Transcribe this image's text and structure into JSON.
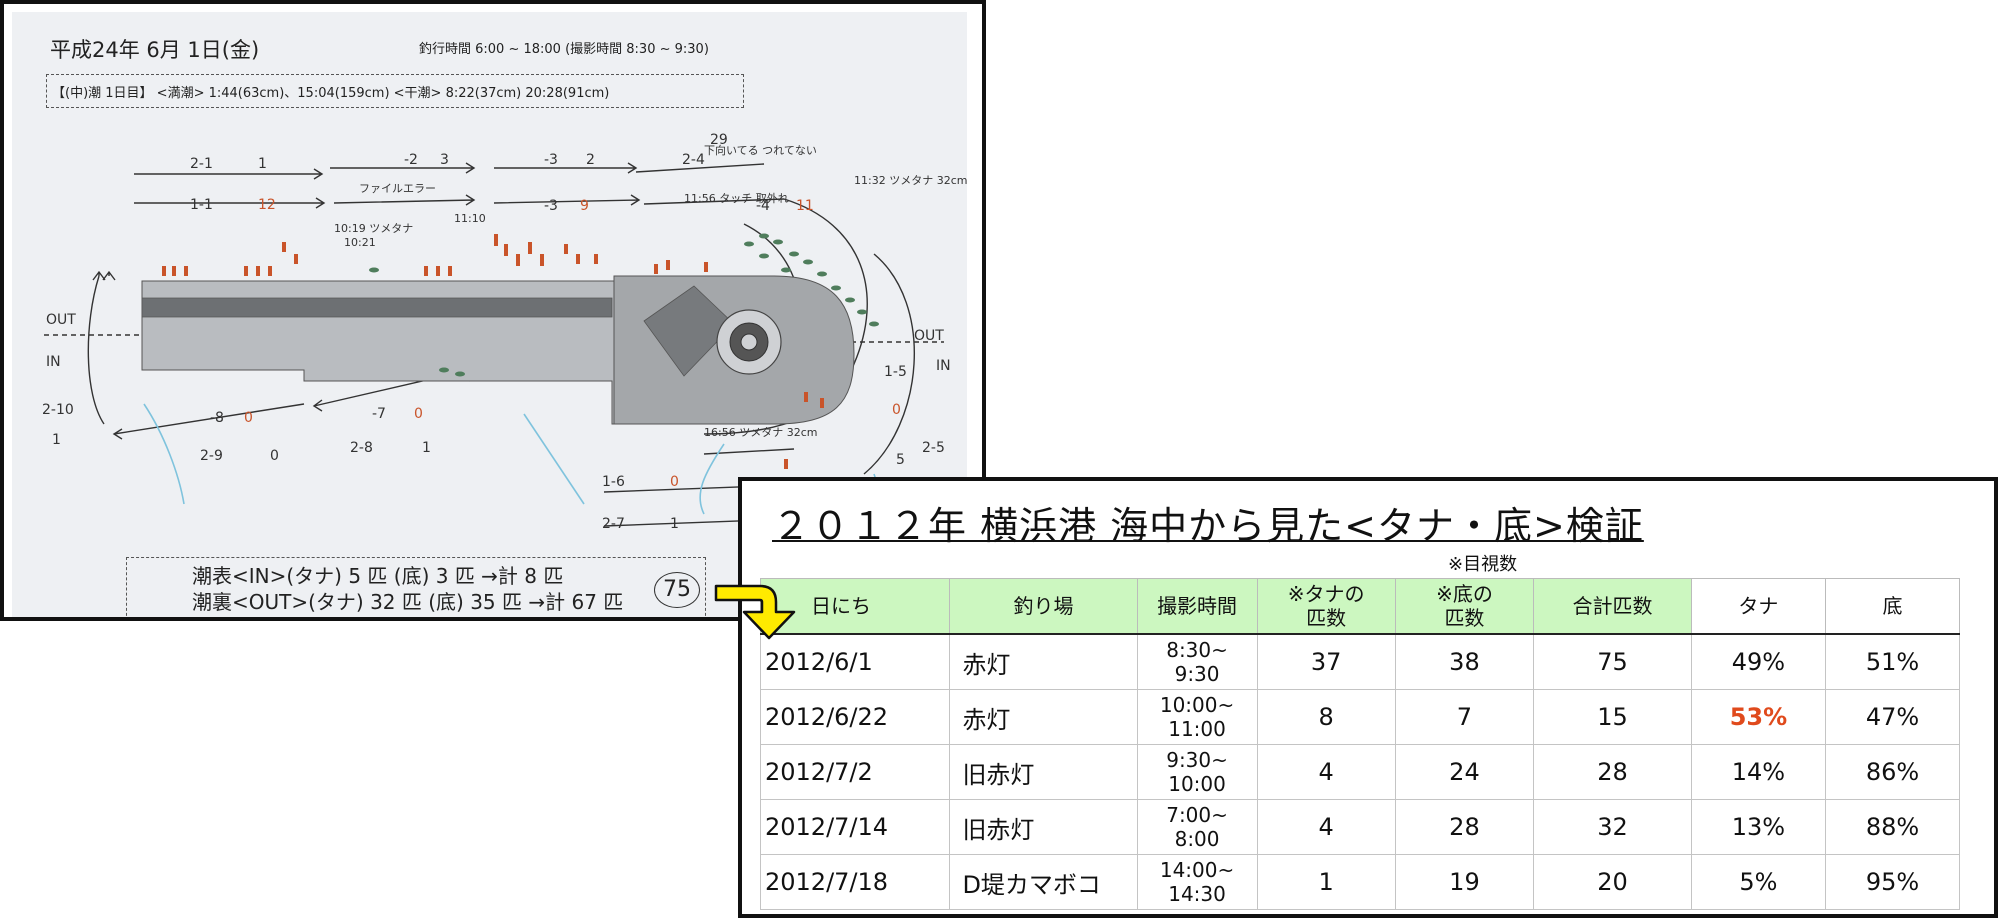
{
  "scan": {
    "header": "平成24年 6月 1日(金)",
    "time_line": "釣行時間 6:00 ~ 18:00 (撮影時間 8:30 ~ 9:30)",
    "tide_line": "【(中)潮 1日目】 <満潮> 1:44(63cm)、15:04(159cm) <干潮> 8:22(37cm) 20:28(91cm)",
    "count_line_1": "潮表<IN>(タナ) 5 匹 (底) 3 匹 →計 8 匹",
    "count_line_2": "潮裏<OUT>(タナ) 32 匹 (底) 35 匹 →計 67 匹",
    "total_circled": "75",
    "diagram_labels": {
      "out_left": "OUT",
      "in_left": "IN",
      "out_right": "OUT",
      "in_right": "IN",
      "left_pass": "2-10",
      "left_pass_count": "1",
      "note_top": "下向いてる つれてない",
      "note_apparent": "ファイルエラー",
      "note_time1": "10:19 ツメタナ",
      "note_time2": "10:21",
      "note_time3": "11:10",
      "note_time4": "11:32 ツメタナ 32cm",
      "note_time5": "16:56 ツメタナ 32cm",
      "note_time6": "11:56 タッチ 取外れ",
      "passes_top": [
        {
          "label": "2-1",
          "count": "1"
        },
        {
          "label": "-2",
          "count": "3"
        },
        {
          "label": "-3",
          "count": "2"
        },
        {
          "label": "2-4",
          "count": "29"
        }
      ],
      "passes_second": [
        {
          "label": "1-1",
          "count": "12"
        },
        {
          "label": "-3",
          "count": "9"
        },
        {
          "label": "-4",
          "count": "11"
        }
      ],
      "passes_bottom": [
        {
          "label": "-8",
          "count": "0"
        },
        {
          "label": "-7",
          "count": "0"
        },
        {
          "label": "2-9",
          "count": "0"
        },
        {
          "label": "2-8",
          "count": "1"
        },
        {
          "label": "1-6",
          "count": "0"
        },
        {
          "label": "2-7",
          "count": "1"
        },
        {
          "label": "1-5",
          "count": "0"
        },
        {
          "label": "2-5",
          "count": "5"
        }
      ]
    }
  },
  "table": {
    "title": "２０１２年 横浜港 海中から見た<タナ・底>検証",
    "visual_note": "※目視数",
    "headers": {
      "date": "日にち",
      "spot": "釣り場",
      "time": "撮影時間",
      "tana_count_1": "※タナの",
      "tana_count_2": "匹数",
      "bottom_count_1": "※底の",
      "bottom_count_2": "匹数",
      "total": "合計匹数",
      "tana_pct": "タナ",
      "bottom_pct": "底"
    },
    "rows": [
      {
        "date": "2012/6/1",
        "spot": "赤灯",
        "time_start": "8:30~",
        "time_end": "9:30",
        "tana": "37",
        "bottom": "38",
        "total": "75",
        "tana_pct": "49%",
        "bottom_pct": "51%"
      },
      {
        "date": "2012/6/22",
        "spot": "赤灯",
        "time_start": "10:00~",
        "time_end": "11:00",
        "tana": "8",
        "bottom": "7",
        "total": "15",
        "tana_pct": "53%",
        "bottom_pct": "47%"
      },
      {
        "date": "2012/7/2",
        "spot": "旧赤灯",
        "time_start": "9:30~",
        "time_end": "10:00",
        "tana": "4",
        "bottom": "24",
        "total": "28",
        "tana_pct": "14%",
        "bottom_pct": "86%"
      },
      {
        "date": "2012/7/14",
        "spot": "旧赤灯",
        "time_start": "7:00~",
        "time_end": "8:00",
        "tana": "4",
        "bottom": "28",
        "total": "32",
        "tana_pct": "13%",
        "bottom_pct": "88%"
      },
      {
        "date": "2012/7/18",
        "spot": "D堤カマボコ",
        "time_start": "14:00~",
        "time_end": "14:30",
        "tana": "1",
        "bottom": "19",
        "total": "20",
        "tana_pct": "5%",
        "bottom_pct": "95%"
      }
    ],
    "highlight_color": "#e04a1c",
    "header_bg": "#ccf7c0",
    "arrow_color": "#ffea00"
  }
}
